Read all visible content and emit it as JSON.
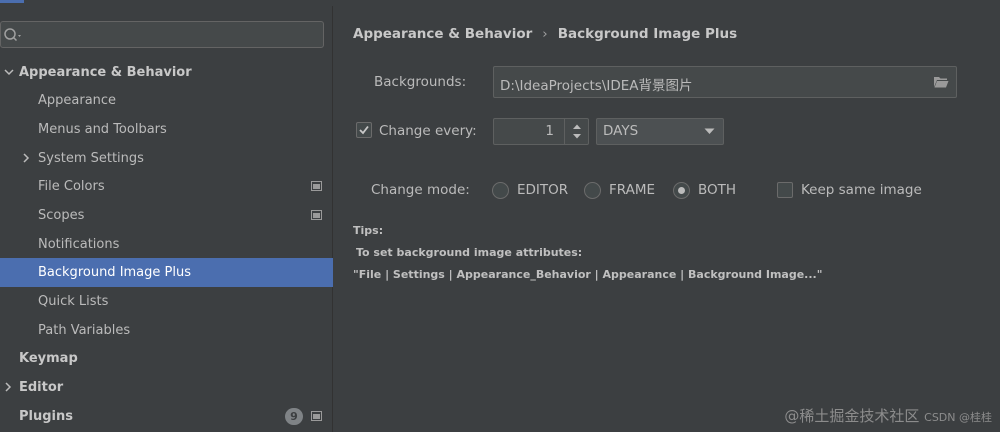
{
  "sidebar": {
    "search": {
      "placeholder": ""
    },
    "items": [
      {
        "label": "Appearance & Behavior"
      },
      {
        "label": "Appearance"
      },
      {
        "label": "Menus and Toolbars"
      },
      {
        "label": "System Settings"
      },
      {
        "label": "File Colors"
      },
      {
        "label": "Scopes"
      },
      {
        "label": "Notifications"
      },
      {
        "label": "Background Image Plus"
      },
      {
        "label": "Quick Lists"
      },
      {
        "label": "Path Variables"
      },
      {
        "label": "Keymap"
      },
      {
        "label": "Editor"
      },
      {
        "label": "Plugins",
        "badge": "9"
      }
    ]
  },
  "breadcrumb": {
    "parent": "Appearance & Behavior",
    "separator": "›",
    "current": "Background Image Plus"
  },
  "form": {
    "backgrounds_label": "Backgrounds:",
    "backgrounds_value": "D:\\IdeaProjects\\IDEA背景图片",
    "change_every_label": "Change every:",
    "change_every_checked": true,
    "change_every_value": "1",
    "change_unit": "DAYS",
    "change_mode_label": "Change mode:",
    "modes": [
      {
        "label": "EDITOR",
        "selected": false
      },
      {
        "label": "FRAME",
        "selected": false
      },
      {
        "label": "BOTH",
        "selected": true
      }
    ],
    "keep_same_label": "Keep same image",
    "keep_same_checked": false
  },
  "tips": {
    "title": "Tips:",
    "line1": "To set background image attributes:",
    "line2": "\"File | Settings | Appearance_Behavior | Appearance | Background Image...\""
  },
  "watermark": {
    "text": "@稀土掘金技术社区",
    "small": "CSDN @桂桂"
  },
  "colors": {
    "accent": "#4b6eaf",
    "background": "#3c3f41"
  }
}
